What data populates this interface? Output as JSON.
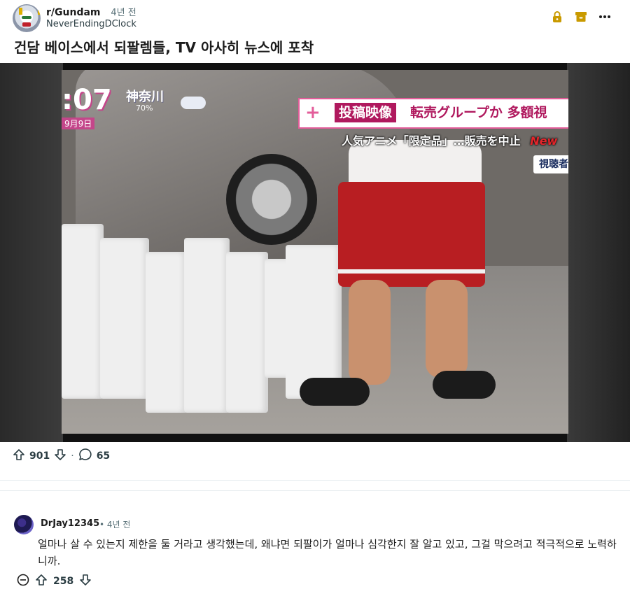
{
  "post": {
    "subreddit": "r/Gundam",
    "time": "4년 전",
    "author": "NeverEndingDClock",
    "title": "건담 베이스에서 되팔렘들, TV 아사히 뉴스에 포착",
    "upvotes": "901",
    "separator": "·",
    "comments": "65"
  },
  "media": {
    "clock": ":07",
    "place": "神奈川",
    "percent": "70%",
    "date": "9月9日",
    "banner_tag": "投稿映像",
    "banner_headline": "転売グループか 多額視",
    "subhead": "人気アニメ「限定品」…販売を中止",
    "subhead_new": "New",
    "viewer_tag": "視聴者"
  },
  "header_icons": [
    "lock-icon",
    "archive-icon",
    "more-options-icon"
  ],
  "comment": {
    "user": "DrJay12345",
    "time": "• 4년 전",
    "body": "얼마나 살 수 있는지 제한을 둘 거라고 생각했는데, 왜냐면 되팔이가 얼마나 심각한지 잘 알고 있고, 그걸 막으려고 적극적으로 노력하니까.",
    "upvotes": "258"
  },
  "colors": {
    "lock_accent": "#c99a00",
    "archive_accent": "#c99a00",
    "banner_magenta": "#b0195e"
  }
}
